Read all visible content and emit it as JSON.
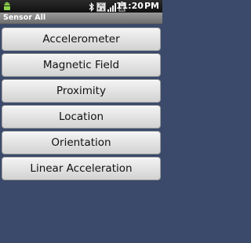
{
  "status_bar": {
    "time": "11:20",
    "ampm_indicator": "PM",
    "icons": [
      "android-debug-icon",
      "bluetooth-icon",
      "data-transfer-icon",
      "signal-icon",
      "battery-icon"
    ]
  },
  "title_bar": {
    "title": "Sensor All"
  },
  "buttons": [
    {
      "label": "Accelerometer"
    },
    {
      "label": "Magnetic Field"
    },
    {
      "label": "Proximity"
    },
    {
      "label": "Location"
    },
    {
      "label": "Orientation"
    },
    {
      "label": "Linear Acceleration"
    }
  ],
  "colors": {
    "background": "#3b4a6b",
    "title_bar": "#8a8a8a",
    "status_bar": "#1a1a1a",
    "button_face": "#e3e3e3"
  }
}
